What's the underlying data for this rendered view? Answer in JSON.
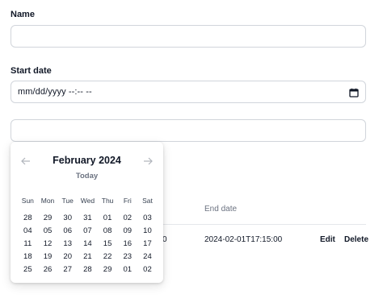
{
  "form": {
    "name_label": "Name",
    "name_value": "",
    "start_label": "Start date",
    "start_value": "mm/dd/yyyy --:-- --",
    "end_value": ""
  },
  "table": {
    "end_header": "End date",
    "row_partial_start": "0",
    "row_end_date": "2024-02-01T17:15:00",
    "edit_label": "Edit",
    "delete_label": "Delete"
  },
  "calendar": {
    "prev_icon": "arrow-left-icon",
    "next_icon": "arrow-right-icon",
    "month_title": "February 2024",
    "today_label": "Today",
    "weekdays": [
      "Sun",
      "Mon",
      "Tue",
      "Wed",
      "Thu",
      "Fri",
      "Sat"
    ],
    "weeks": [
      [
        "28",
        "29",
        "30",
        "31",
        "01",
        "02",
        "03"
      ],
      [
        "04",
        "05",
        "06",
        "07",
        "08",
        "09",
        "10"
      ],
      [
        "11",
        "12",
        "13",
        "14",
        "15",
        "16",
        "17"
      ],
      [
        "18",
        "19",
        "20",
        "21",
        "22",
        "23",
        "24"
      ],
      [
        "25",
        "26",
        "27",
        "28",
        "29",
        "01",
        "02"
      ]
    ]
  },
  "colors": {
    "border": "#d1d5db",
    "muted_text": "#6b7280",
    "nav_arrow": "#b0b4bb"
  }
}
